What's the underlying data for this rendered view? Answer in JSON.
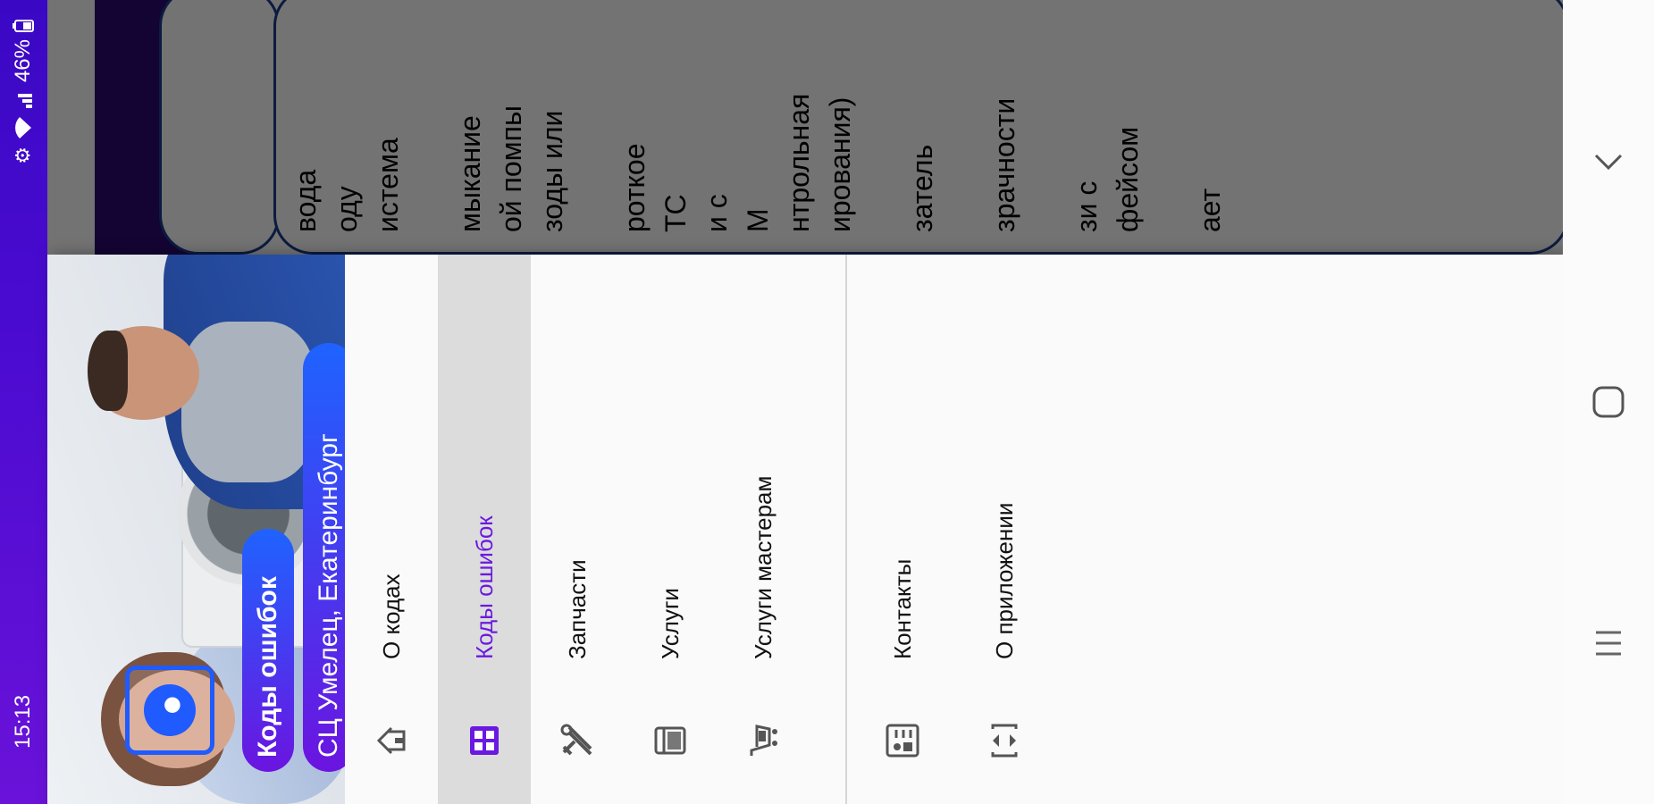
{
  "status_bar": {
    "time": "15:13",
    "battery": "46%",
    "icons": [
      "settings-icon",
      "wifi-icon",
      "signal-icon",
      "battery-icon"
    ]
  },
  "table": {
    "lines": [
      "вода",
      "оду",
      "истема",
      "",
      "мыкание",
      "ой помпы",
      "зоды или",
      "",
      "роткое",
      "ТС",
      "и с",
      "М",
      "нтрольная",
      "ирования)",
      "",
      "затель",
      "",
      "зрачности",
      "",
      "зи с",
      "фейсом",
      "",
      "ает"
    ]
  },
  "drawer": {
    "header": {
      "title": "Коды ошибок",
      "subtitle": "СЦ Умелец, Екатеринбург",
      "logo": "swirl-logo-icon"
    },
    "items": [
      {
        "label": "О кодах",
        "icon": "home-icon",
        "active": false
      },
      {
        "label": "Коды ошибок",
        "icon": "code-grid-icon",
        "active": true
      },
      {
        "label": "Запчасти",
        "icon": "tools-icon",
        "active": false
      },
      {
        "label": "Услуги",
        "icon": "washer-icon",
        "active": false
      },
      {
        "label": "Услуги мастерам",
        "icon": "cart-icon",
        "active": false
      },
      {
        "label": "Контакты",
        "icon": "contact-card-icon",
        "active": false
      },
      {
        "label": "О приложении",
        "icon": "expand-icon",
        "active": false
      }
    ]
  },
  "colors": {
    "accent": "#6a19e0",
    "status_bar": "#5a10d6",
    "toolbar": "#2a0a72",
    "table_border": "#1b3c8c"
  },
  "nav_bar": {
    "buttons": [
      "recent-apps-icon",
      "home-circle-icon",
      "back-chevron-icon"
    ]
  }
}
